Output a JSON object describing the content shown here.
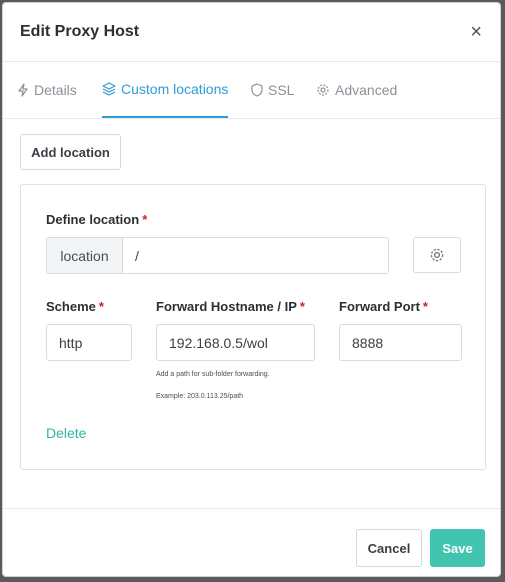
{
  "modal": {
    "title": "Edit Proxy Host",
    "close_glyph": "×"
  },
  "tabs": [
    {
      "label": "Details",
      "icon": "bolt-icon",
      "active": false
    },
    {
      "label": "Custom locations",
      "icon": "layers-icon",
      "active": true
    },
    {
      "label": "SSL",
      "icon": "shield-icon",
      "active": false
    },
    {
      "label": "Advanced",
      "icon": "gear-icon",
      "active": false
    }
  ],
  "toolbar": {
    "add_location_label": "Add location"
  },
  "location": {
    "define_label": "Define location",
    "addon_label": "location",
    "path_value": "/",
    "scheme_label": "Scheme",
    "scheme_value": "http",
    "hostname_label": "Forward Hostname / IP",
    "hostname_value": "192.168.0.5/wol",
    "port_label": "Forward Port",
    "port_value": "8888",
    "hint_1": "Add a path for sub-folder forwarding.",
    "hint_2": "Example: 203.0.113.25/path",
    "delete_label": "Delete",
    "required_mark": "*"
  },
  "footer": {
    "cancel_label": "Cancel",
    "save_label": "Save"
  },
  "colors": {
    "accent": "#2f9cd9",
    "save_button": "#41c4b0",
    "delete_link": "#2fb5a5",
    "required": "#cd201f"
  }
}
